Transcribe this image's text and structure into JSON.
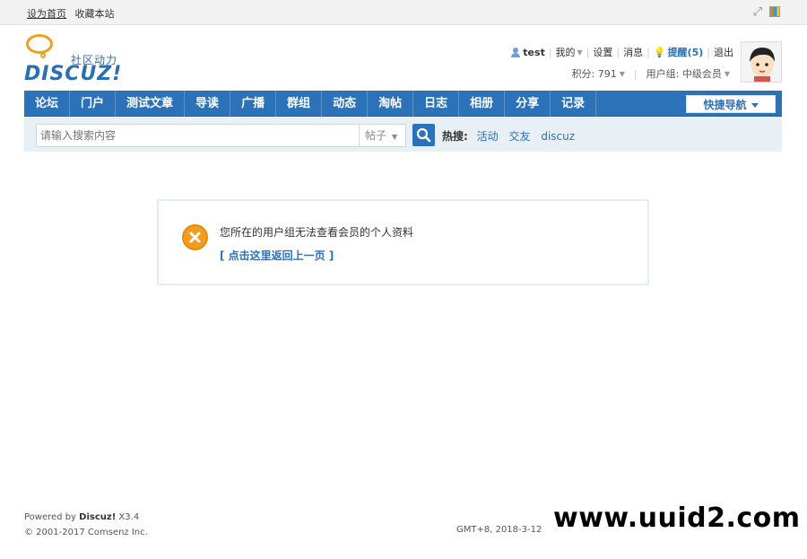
{
  "topbar": {
    "set_home": "设为首页",
    "bookmark": "收藏本站"
  },
  "logo": {
    "slogan": "社区动力",
    "brand": "DISCUZ!"
  },
  "user": {
    "name": "test",
    "my": "我的",
    "settings": "设置",
    "messages": "消息",
    "reminder": "提醒(5)",
    "logout": "退出",
    "points": "积分: 791",
    "group": "用户组: 中级会员"
  },
  "nav": {
    "items": [
      "论坛",
      "门户",
      "测试文章",
      "导读",
      "广播",
      "群组",
      "动态",
      "淘帖",
      "日志",
      "相册",
      "分享",
      "记录"
    ],
    "quick": "快捷导航"
  },
  "search": {
    "placeholder": "请输入搜索内容",
    "type": "帖子",
    "hot_label": "热搜:",
    "hot_items": [
      "活动",
      "交友",
      "discuz"
    ]
  },
  "message": {
    "text": "您所在的用户组无法查看会员的个人资料",
    "back": "[ 点击这里返回上一页 ]"
  },
  "footer": {
    "powered_prefix": "Powered by ",
    "powered_brand": "Discuz!",
    "version": " X3.4",
    "copyright": "© 2001-2017 Comsenz Inc.",
    "time": "GMT+8, 2018-3-12 0"
  },
  "watermark": "www.uuid2.com",
  "colors": {
    "nav_bg": "#2b72b8",
    "accent": "#2b72b8",
    "error_icon": "#f39c1e"
  }
}
